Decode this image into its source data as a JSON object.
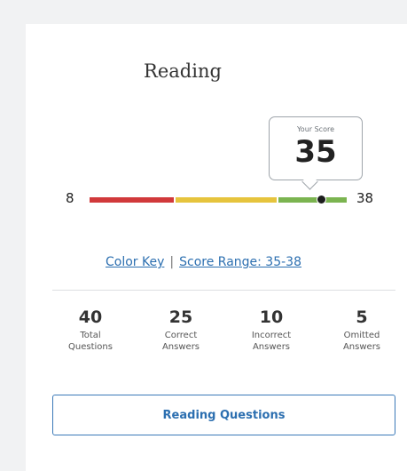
{
  "section": {
    "title": "Reading"
  },
  "score": {
    "caption": "Your Score",
    "value": "35",
    "numeric": 35
  },
  "scale": {
    "min": "8",
    "max": "38",
    "min_value": 8,
    "max_value": 38,
    "segments": [
      {
        "from": 8,
        "to": 18,
        "color": "#d1393b"
      },
      {
        "from": 18,
        "to": 30,
        "color": "#e6c43d"
      },
      {
        "from": 30,
        "to": 38,
        "color": "#7bb450"
      }
    ]
  },
  "links": {
    "color_key": "Color Key",
    "separator": "|",
    "score_range": "Score Range: 35-38"
  },
  "stats": [
    {
      "value": "40",
      "line1": "Total",
      "line2": "Questions"
    },
    {
      "value": "25",
      "line1": "Correct",
      "line2": "Answers"
    },
    {
      "value": "10",
      "line1": "Incorrect",
      "line2": "Answers"
    },
    {
      "value": "5",
      "line1": "Omitted",
      "line2": "Answers"
    }
  ],
  "button": {
    "label": "Reading Questions"
  },
  "colors": {
    "link": "#2c6fb0",
    "red": "#d1393b",
    "yellow": "#e6c43d",
    "green": "#7bb450"
  }
}
